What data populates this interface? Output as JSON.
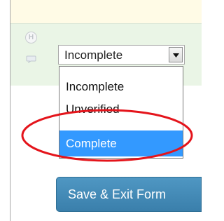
{
  "form": {
    "field_icons": {
      "history_icon": "H",
      "comment_icon": "comment-icon"
    },
    "status_select": {
      "selected_value": "Incomplete",
      "options": [
        "Incomplete",
        "Unverified",
        "Complete"
      ],
      "highlighted_option": "Complete"
    },
    "save_exit_button_label": "Save & Exit Form"
  },
  "colors": {
    "highlight_blue": "#3399ff",
    "annotation_red": "#e4141b",
    "button_blue": "#3f86b3",
    "row_green": "#eaf5e6",
    "top_yellow": "#fffbe6"
  }
}
